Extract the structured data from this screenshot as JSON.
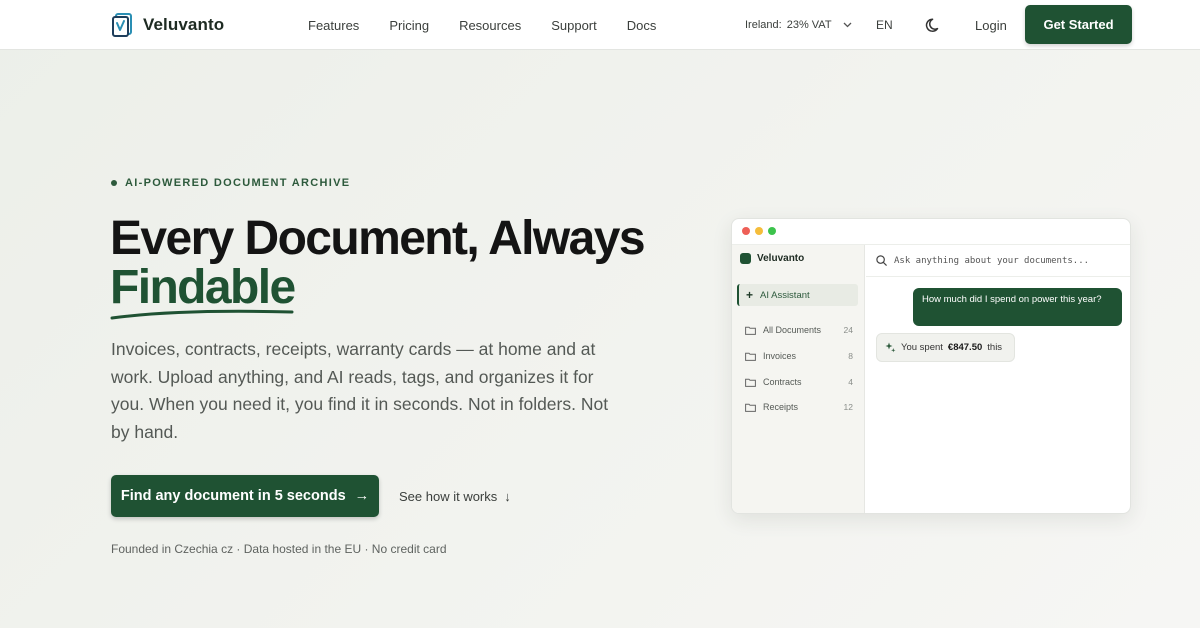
{
  "brand": {
    "name": "Veluvanto"
  },
  "nav": {
    "links": [
      "Features",
      "Pricing",
      "Resources",
      "Support",
      "Docs"
    ],
    "vat": {
      "country": "Ireland:",
      "rate": "23% VAT"
    },
    "language": "EN",
    "login": "Login",
    "cta": "Get Started"
  },
  "hero": {
    "eyebrow": "AI-POWERED DOCUMENT ARCHIVE",
    "headline_line1": "Every Document, Always",
    "headline_accent": "Findable",
    "subtext": "Invoices, contracts, receipts, warranty cards — at home and at work. Upload anything, and AI reads, tags, and organizes it for you. When you need it, you find it in seconds. Not in folders. Not by hand.",
    "cta_primary": "Find any document in 5 seconds",
    "cta_primary_arrow": "→",
    "cta_secondary": "See how it works",
    "cta_secondary_arrow": "↓",
    "footnote": "Founded in Czechia cz · Data hosted in the EU · No credit card"
  },
  "mockup": {
    "app_name": "Veluvanto",
    "ai_assistant": "AI Assistant",
    "folders": [
      {
        "label": "All Documents",
        "count": "24"
      },
      {
        "label": "Invoices",
        "count": "8"
      },
      {
        "label": "Contracts",
        "count": "4"
      },
      {
        "label": "Receipts",
        "count": "12"
      }
    ],
    "search_placeholder": "Ask anything about your documents...",
    "user_message": "How much did I spend on power this year?",
    "ai_reply_prefix": "You spent",
    "ai_reply_amount": "€847.50",
    "ai_reply_suffix": "this"
  },
  "colors": {
    "brand_green": "#1f5233",
    "accent_text": "#2d5a3c",
    "background": "#eff1ec"
  }
}
